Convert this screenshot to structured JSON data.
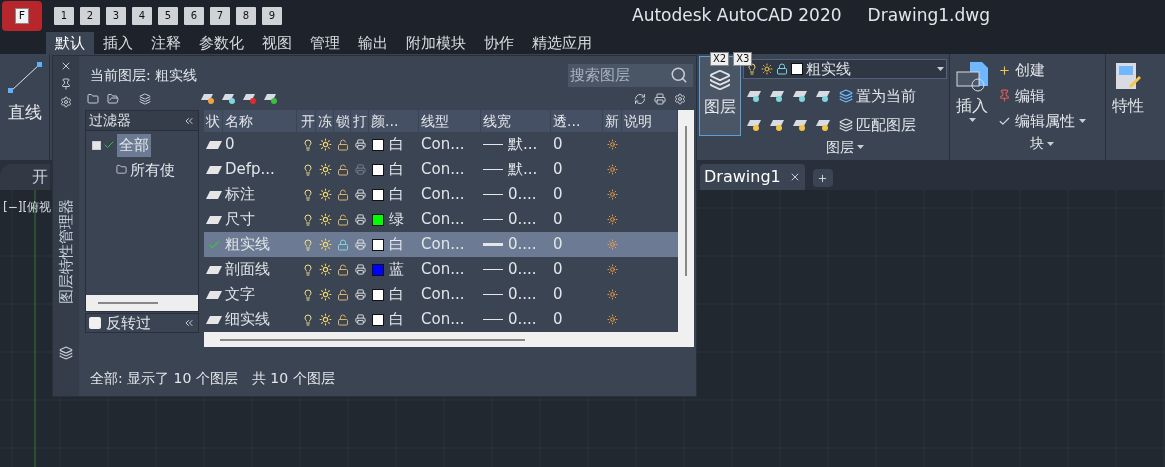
{
  "title_bar": {
    "app_keytip": "F",
    "quick_access_keytips": [
      "1",
      "2",
      "3",
      "4",
      "5",
      "6",
      "7",
      "8",
      "9"
    ],
    "title": "Autodesk AutoCAD 2020",
    "document": "Drawing1.dwg"
  },
  "ribbon_tabs": [
    {
      "label": "默认",
      "selected": true
    },
    {
      "label": "插入",
      "selected": false
    },
    {
      "label": "注释",
      "selected": false
    },
    {
      "label": "参数化",
      "selected": false
    },
    {
      "label": "视图",
      "selected": false
    },
    {
      "label": "管理",
      "selected": false
    },
    {
      "label": "输出",
      "selected": false
    },
    {
      "label": "附加模块",
      "selected": false
    },
    {
      "label": "协作",
      "selected": false
    },
    {
      "label": "精选应用",
      "selected": false
    }
  ],
  "ribbon": {
    "draw": {
      "line": "直线"
    },
    "layers": {
      "keytip_badges": [
        "X2",
        "X3"
      ],
      "properties_button": "图层",
      "current_layer": {
        "name": "粗实线",
        "color": "#ffffff"
      },
      "make_current": "置为当前",
      "match_layer": "匹配图层",
      "group_label": "图层"
    },
    "block": {
      "insert": "插入",
      "create": "创建",
      "edit": "编辑",
      "edit_attributes": "编辑属性",
      "group_label": "块"
    },
    "properties": {
      "label": "特性"
    }
  },
  "file_tabs": [
    {
      "label": "开",
      "selected": false
    },
    {
      "label": "Drawing1",
      "selected": true
    }
  ],
  "viewport_label": "[−][俯视",
  "layer_palette": {
    "side_title": "图层特性管理器",
    "current_layer_label": "当前图层: 粗实线",
    "search_placeholder": "搜索图层",
    "filters": {
      "header": "过滤器",
      "tree": [
        {
          "label": "全部",
          "selected": true,
          "children": [
            {
              "label": "所有使",
              "selected": false
            }
          ]
        }
      ],
      "invert": {
        "label": "反转过",
        "checked": false
      }
    },
    "columns": [
      "状",
      "名称",
      "开",
      "冻",
      "锁",
      "打",
      "颜...",
      "线型",
      "线宽",
      "透...",
      "新",
      "说明"
    ],
    "rows": [
      {
        "name": "0",
        "current": false,
        "selected": false,
        "locked": false,
        "plot": true,
        "color": "#ffffff",
        "color_name": "白",
        "linetype": "Con...",
        "lineweight": "默...",
        "heavy": false,
        "transparency": "0"
      },
      {
        "name": "Defp...",
        "current": false,
        "selected": false,
        "locked": false,
        "plot": false,
        "color": "#ffffff",
        "color_name": "白",
        "linetype": "Con...",
        "lineweight": "默...",
        "heavy": false,
        "transparency": "0"
      },
      {
        "name": "标注",
        "current": false,
        "selected": false,
        "locked": false,
        "plot": true,
        "color": "#ffffff",
        "color_name": "白",
        "linetype": "Con...",
        "lineweight": "0....",
        "heavy": false,
        "transparency": "0"
      },
      {
        "name": "尺寸",
        "current": false,
        "selected": false,
        "locked": false,
        "plot": true,
        "color": "#00ff00",
        "color_name": "绿",
        "linetype": "Con...",
        "lineweight": "0....",
        "heavy": false,
        "transparency": "0"
      },
      {
        "name": "粗实线",
        "current": true,
        "selected": true,
        "locked": true,
        "plot": true,
        "color": "#ffffff",
        "color_name": "白",
        "linetype": "Con...",
        "lineweight": "0....",
        "heavy": true,
        "transparency": "0"
      },
      {
        "name": "剖面线",
        "current": false,
        "selected": false,
        "locked": false,
        "plot": true,
        "color": "#0000ff",
        "color_name": "蓝",
        "linetype": "Con...",
        "lineweight": "0....",
        "heavy": false,
        "transparency": "0"
      },
      {
        "name": "文字",
        "current": false,
        "selected": false,
        "locked": false,
        "plot": true,
        "color": "#ffffff",
        "color_name": "白",
        "linetype": "Con...",
        "lineweight": "0....",
        "heavy": false,
        "transparency": "0"
      },
      {
        "name": "细实线",
        "current": false,
        "selected": false,
        "locked": false,
        "plot": true,
        "color": "#ffffff",
        "color_name": "白",
        "linetype": "Con...",
        "lineweight": "0....",
        "heavy": false,
        "transparency": "0"
      }
    ],
    "status": [
      "全部: 显示了 10 个图层",
      "共 10 个图层"
    ]
  }
}
